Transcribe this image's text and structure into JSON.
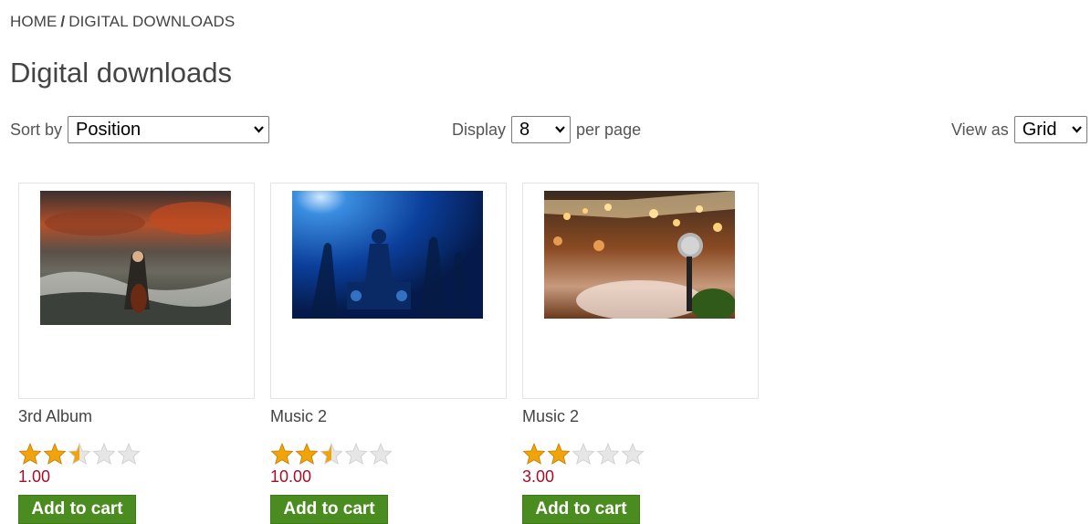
{
  "breadcrumb": {
    "home": "HOME",
    "separator": "/",
    "current": "DIGITAL DOWNLOADS"
  },
  "page": {
    "title": "Digital downloads"
  },
  "toolbar": {
    "sort_label": "Sort by",
    "sort_value": "Position",
    "display_label": "Display",
    "display_value": "8",
    "per_page_label": "per page",
    "view_label": "View as",
    "view_value": "Grid"
  },
  "products": [
    {
      "name": "3rd Album",
      "rating": 2.5,
      "rating_max": 5,
      "price": "1.00",
      "button": "Add to cart",
      "image": "dramatic-sea-cellist-photo"
    },
    {
      "name": "Music 2",
      "rating": 2.5,
      "rating_max": 5,
      "price": "10.00",
      "button": "Add to cart",
      "image": "blue-concert-crowd-photo"
    },
    {
      "name": "Music 2",
      "rating": 2,
      "rating_max": 5,
      "price": "3.00",
      "button": "Add to cart",
      "image": "microphone-bokeh-stage-photo"
    }
  ],
  "colors": {
    "price": "#a3102a",
    "button_bg": "#4a8c1f",
    "star_filled": "#f0a30a",
    "star_empty": "#dddddd"
  }
}
